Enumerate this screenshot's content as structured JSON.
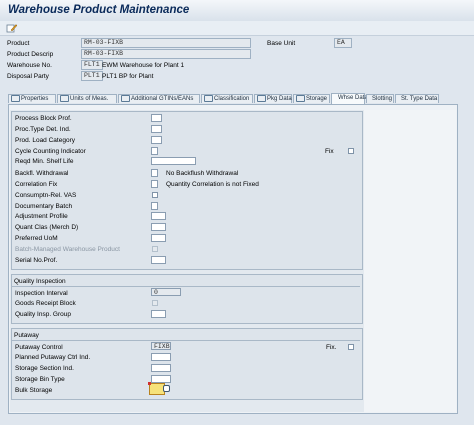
{
  "window": {
    "title": "Warehouse Product Maintenance"
  },
  "toolbar": {
    "edit_icon": "pencil-edit-icon"
  },
  "header": {
    "product_label": "Product",
    "product_value": "RM-03-FIXB",
    "product_descrip_label": "Product Descrip",
    "product_descrip_value": "RM-03-FIXB",
    "warehouse_no_label": "Warehouse No.",
    "warehouse_no_value": "FLT1",
    "warehouse_no_desc": "EWM Warehouse for Plant 1",
    "disposal_party_label": "Disposal Party",
    "disposal_party_value": "PLT1",
    "disposal_party_desc": "PLT1 BP for Plant",
    "base_unit_label": "Base Unit",
    "base_unit_value": "EA"
  },
  "tabs": [
    {
      "label": "Properties",
      "icon": "edit-tab-icon",
      "active": false
    },
    {
      "label": "Units of Meas.",
      "icon": "edit-tab-icon",
      "active": false
    },
    {
      "label": "Additional GTINs/EANs",
      "icon": "edit-tab-icon",
      "active": false
    },
    {
      "label": "Classification",
      "icon": "edit-tab-icon",
      "active": false
    },
    {
      "label": "Pkg Data",
      "icon": "edit-tab-icon",
      "active": false
    },
    {
      "label": "Storage",
      "icon": "edit-tab-icon",
      "active": false
    },
    {
      "label": "Whse Data",
      "icon": "",
      "active": true
    },
    {
      "label": "Slotting",
      "icon": "",
      "active": false
    },
    {
      "label": "St. Type Data",
      "icon": "",
      "active": false
    }
  ],
  "general": {
    "process_block_prof": "Process Block Prof.",
    "proc_type_det_ind": "Proc.Type Det. Ind.",
    "prod_load_category": "Prod. Load Category",
    "cycle_counting_indicator": "Cycle Counting Indicator",
    "fix_label": "Fix",
    "reqd_min_shelf_life": "Reqd Min. Shelf Life",
    "backfl_withdrawal": "Backfl. Withdrawal",
    "backfl_withdrawal_desc": "No Backflush Withdrawal",
    "correlation_fix": "Correlation Fix",
    "correlation_fix_desc": "Quantity Correlation is not Fixed",
    "consumptn_rel_vas": "Consumptn-Rel. VAS",
    "documentary_batch": "Documentary Batch",
    "adjustment_profile": "Adjustment Profile",
    "quant_clas": "Quant Clas (Merch D)",
    "preferred_uom": "Preferred UoM",
    "batch_managed": "Batch-Managed Warehouse Product",
    "serial_no_prof": "Serial No.Prof."
  },
  "quality_inspection": {
    "heading": "Quality Inspection",
    "inspection_interval": "Inspection Interval",
    "inspection_interval_value": "0",
    "goods_receipt_block": "Goods Receipt Block",
    "quality_insp_group": "Quality Insp. Group"
  },
  "putaway": {
    "heading": "Putaway",
    "putaway_control": "Putaway Control",
    "putaway_control_value": "FIXB",
    "fix_label": "Fix.",
    "planned_putaway_ctrl_ind": "Planned Putaway Ctrl Ind.",
    "storage_section_ind": "Storage Section Ind.",
    "storage_bin_type": "Storage Bin Type",
    "bulk_storage": "Bulk Storage"
  },
  "colors": {
    "title": "#0a2a5a",
    "focus_field": "#f6e27a"
  }
}
